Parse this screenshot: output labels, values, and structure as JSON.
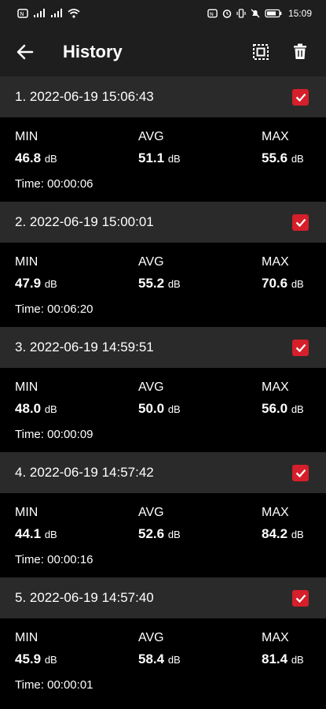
{
  "status_bar": {
    "left_indicators": [
      "nfc-icon",
      "signal-icon",
      "signal-icon",
      "wifi-icon"
    ],
    "right_indicators": [
      "nfc-icon",
      "alarm-icon",
      "vibrate-icon",
      "mute-icon",
      "battery-icon"
    ],
    "time": "15:09"
  },
  "appbar": {
    "title": "History",
    "back_icon": "arrow-left-icon",
    "select_all_icon": "select-all-icon",
    "delete_icon": "trash-icon"
  },
  "colors": {
    "accent": "#d51f2a",
    "header_bg": "#2a2a2a",
    "appbar_bg": "#1e1e1e",
    "body_bg": "#000000"
  },
  "labels": {
    "min": "MIN",
    "avg": "AVG",
    "max": "MAX",
    "unit": "dB"
  },
  "records": [
    {
      "header": "1. 2022-06-19 15:06:43",
      "min": "46.8",
      "avg": "51.1",
      "max": "55.6",
      "time": "Time: 00:00:06",
      "checked": true
    },
    {
      "header": "2. 2022-06-19 15:00:01",
      "min": "47.9",
      "avg": "55.2",
      "max": "70.6",
      "time": "Time: 00:06:20",
      "checked": true
    },
    {
      "header": "3. 2022-06-19 14:59:51",
      "min": "48.0",
      "avg": "50.0",
      "max": "56.0",
      "time": "Time: 00:00:09",
      "checked": true
    },
    {
      "header": "4. 2022-06-19 14:57:42",
      "min": "44.1",
      "avg": "52.6",
      "max": "84.2",
      "time": "Time: 00:00:16",
      "checked": true
    },
    {
      "header": "5. 2022-06-19 14:57:40",
      "min": "45.9",
      "avg": "58.4",
      "max": "81.4",
      "time": "Time: 00:00:01",
      "checked": true
    }
  ]
}
